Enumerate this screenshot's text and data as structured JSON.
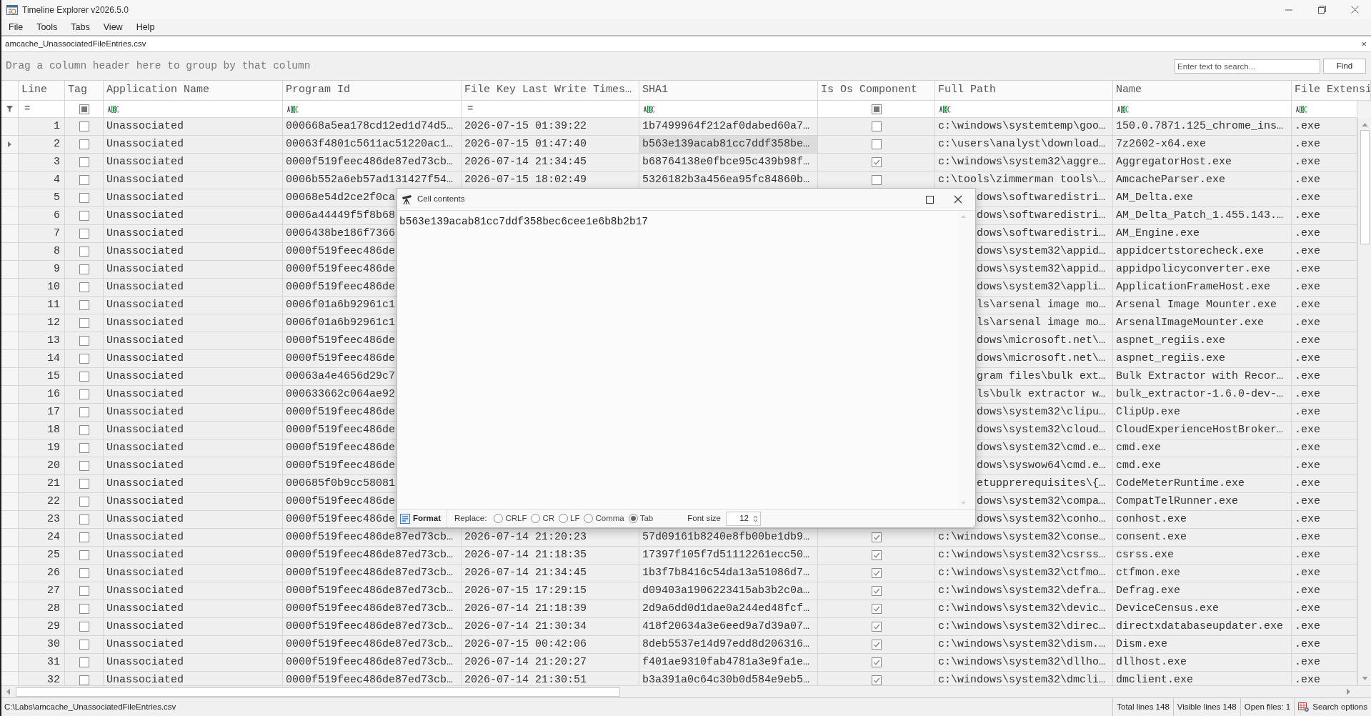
{
  "window": {
    "title": "Timeline Explorer v2026.5.0"
  },
  "menu": [
    "File",
    "Tools",
    "Tabs",
    "View",
    "Help"
  ],
  "tab": {
    "label": "amcache_UnassociatedFileEntries.csv",
    "close": "×"
  },
  "group_panel": {
    "hint": "Drag a column header here to group by that column"
  },
  "search": {
    "placeholder": "Enter text to search...",
    "button": "Find"
  },
  "columns": [
    {
      "label": "Line",
      "kind": "number",
      "filter": "="
    },
    {
      "label": "Tag",
      "kind": "check",
      "filter_indeterminate": true
    },
    {
      "label": "Application Name",
      "kind": "text"
    },
    {
      "label": "Program Id",
      "kind": "text"
    },
    {
      "label": "File Key Last Write Times…",
      "kind": "number",
      "filter": "="
    },
    {
      "label": "SHA1",
      "kind": "text"
    },
    {
      "label": "Is Os Component",
      "kind": "check",
      "filter_indeterminate": true
    },
    {
      "label": "Full Path",
      "kind": "text"
    },
    {
      "label": "Name",
      "kind": "text"
    },
    {
      "label": "File Extensi",
      "kind": "text"
    }
  ],
  "rows": [
    {
      "line": "1",
      "tagged": false,
      "app": "Unassociated",
      "program_id": "000668a5ea178cd12ed1d74d5…",
      "file_key_time": "2026-07-15 01:39:22",
      "sha1": "1b7499964f212af0dabed60a7…",
      "os_component": false,
      "full_path": "c:\\windows\\systemtemp\\goo…",
      "name": "150.0.7871.125_chrome_ins…",
      "ext": ".exe",
      "selected": false
    },
    {
      "line": "2",
      "tagged": false,
      "app": "Unassociated",
      "program_id": "00063f4801c5611ac51220ac1…",
      "file_key_time": "2026-07-15 01:47:40",
      "sha1": "b563e139acab81cc7ddf358be…",
      "os_component": false,
      "full_path": "c:\\users\\analyst\\download…",
      "name": "7z2602-x64.exe",
      "ext": ".exe",
      "selected": true
    },
    {
      "line": "3",
      "tagged": false,
      "app": "Unassociated",
      "program_id": "0000f519feec486de87ed73cb…",
      "file_key_time": "2026-07-14 21:34:45",
      "sha1": "b68764138e0fbce95c439b98f…",
      "os_component": true,
      "full_path": "c:\\windows\\system32\\aggre…",
      "name": "AggregatorHost.exe",
      "ext": ".exe",
      "selected": false
    },
    {
      "line": "4",
      "tagged": false,
      "app": "Unassociated",
      "program_id": "0006b552a6eb57ad131427f54…",
      "file_key_time": "2026-07-15 18:02:49",
      "sha1": "5326182b3a456ea95fc84860b…",
      "os_component": false,
      "full_path": "c:\\tools\\zimmerman tools\\…",
      "name": "AmcacheParser.exe",
      "ext": ".exe",
      "selected": false
    },
    {
      "line": "5",
      "tagged": false,
      "app": "Unassociated",
      "program_id": "00068e54d2ce2f0ca",
      "full_path": "dows\\softwaredistri…",
      "name": "AM_Delta.exe",
      "ext": ".exe",
      "selected": false
    },
    {
      "line": "6",
      "tagged": false,
      "app": "Unassociated",
      "program_id": "0006a44449f5f8b68",
      "full_path": "dows\\softwaredistri…",
      "name": "AM_Delta_Patch_1.455.143.…",
      "ext": ".exe",
      "selected": false
    },
    {
      "line": "7",
      "tagged": false,
      "app": "Unassociated",
      "program_id": "0006438be186f7366",
      "full_path": "dows\\softwaredistri…",
      "name": "AM_Engine.exe",
      "ext": ".exe",
      "selected": false
    },
    {
      "line": "8",
      "tagged": false,
      "app": "Unassociated",
      "program_id": "0000f519feec486de",
      "full_path": "dows\\system32\\appid…",
      "name": "appidcertstorecheck.exe",
      "ext": ".exe",
      "selected": false
    },
    {
      "line": "9",
      "tagged": false,
      "app": "Unassociated",
      "program_id": "0000f519feec486de",
      "full_path": "dows\\system32\\appid…",
      "name": "appidpolicyconverter.exe",
      "ext": ".exe",
      "selected": false
    },
    {
      "line": "10",
      "tagged": false,
      "app": "Unassociated",
      "program_id": "0000f519feec486de",
      "full_path": "dows\\system32\\appli…",
      "name": "ApplicationFrameHost.exe",
      "ext": ".exe",
      "selected": false
    },
    {
      "line": "11",
      "tagged": false,
      "app": "Unassociated",
      "program_id": "0006f01a6b92961c1",
      "full_path": "ls\\arsenal image mo…",
      "name": "Arsenal Image Mounter.exe",
      "ext": ".exe",
      "selected": false
    },
    {
      "line": "12",
      "tagged": false,
      "app": "Unassociated",
      "program_id": "0006f01a6b92961c1",
      "full_path": "ls\\arsenal image mo…",
      "name": "ArsenalImageMounter.exe",
      "ext": ".exe",
      "selected": false
    },
    {
      "line": "13",
      "tagged": false,
      "app": "Unassociated",
      "program_id": "0000f519feec486de",
      "full_path": "dows\\microsoft.net\\…",
      "name": "aspnet_regiis.exe",
      "ext": ".exe",
      "selected": false
    },
    {
      "line": "14",
      "tagged": false,
      "app": "Unassociated",
      "program_id": "0000f519feec486de",
      "full_path": "dows\\microsoft.net\\…",
      "name": "aspnet_regiis.exe",
      "ext": ".exe",
      "selected": false
    },
    {
      "line": "15",
      "tagged": false,
      "app": "Unassociated",
      "program_id": "00063a4e4656d29c7",
      "full_path": "gram files\\bulk ext…",
      "name": "Bulk Extractor with Recor…",
      "ext": ".exe",
      "selected": false
    },
    {
      "line": "16",
      "tagged": false,
      "app": "Unassociated",
      "program_id": "000633662c064ae92",
      "full_path": "ls\\bulk extractor w…",
      "name": "bulk_extractor-1.6.0-dev-…",
      "ext": ".exe",
      "selected": false
    },
    {
      "line": "17",
      "tagged": false,
      "app": "Unassociated",
      "program_id": "0000f519feec486de",
      "full_path": "dows\\system32\\clipu…",
      "name": "ClipUp.exe",
      "ext": ".exe",
      "selected": false
    },
    {
      "line": "18",
      "tagged": false,
      "app": "Unassociated",
      "program_id": "0000f519feec486de",
      "full_path": "dows\\system32\\cloud…",
      "name": "CloudExperienceHostBroker…",
      "ext": ".exe",
      "selected": false
    },
    {
      "line": "19",
      "tagged": false,
      "app": "Unassociated",
      "program_id": "0000f519feec486de",
      "full_path": "dows\\system32\\cmd.e…",
      "name": "cmd.exe",
      "ext": ".exe",
      "selected": false
    },
    {
      "line": "20",
      "tagged": false,
      "app": "Unassociated",
      "program_id": "0000f519feec486de",
      "full_path": "dows\\syswow64\\cmd.e…",
      "name": "cmd.exe",
      "ext": ".exe",
      "selected": false
    },
    {
      "line": "21",
      "tagged": false,
      "app": "Unassociated",
      "program_id": "000685f0b9cc58081",
      "full_path": "etupprerequisites\\{…",
      "name": "CodeMeterRuntime.exe",
      "ext": ".exe",
      "selected": false
    },
    {
      "line": "22",
      "tagged": false,
      "app": "Unassociated",
      "program_id": "0000f519feec486de",
      "full_path": "dows\\system32\\compa…",
      "name": "CompatTelRunner.exe",
      "ext": ".exe",
      "selected": false
    },
    {
      "line": "23",
      "tagged": false,
      "app": "Unassociated",
      "program_id": "0000f519feec486de",
      "full_path": "dows\\system32\\conho…",
      "name": "conhost.exe",
      "ext": ".exe",
      "selected": false
    },
    {
      "line": "24",
      "tagged": false,
      "app": "Unassociated",
      "program_id": "0000f519feec486de87ed73cb…",
      "file_key_time": "2026-07-14 21:20:23",
      "sha1": "57d09161b8240e8fb00be1db9…",
      "os_component": true,
      "full_path": "c:\\windows\\system32\\conse…",
      "name": "consent.exe",
      "ext": ".exe",
      "selected": false
    },
    {
      "line": "25",
      "tagged": false,
      "app": "Unassociated",
      "program_id": "0000f519feec486de87ed73cb…",
      "file_key_time": "2026-07-14 21:18:35",
      "sha1": "17397f105f7d51112261ecc50…",
      "os_component": true,
      "full_path": "c:\\windows\\system32\\csrss…",
      "name": "csrss.exe",
      "ext": ".exe",
      "selected": false
    },
    {
      "line": "26",
      "tagged": false,
      "app": "Unassociated",
      "program_id": "0000f519feec486de87ed73cb…",
      "file_key_time": "2026-07-14 21:34:45",
      "sha1": "1b3f7b8416c54da13a51086d7…",
      "os_component": true,
      "full_path": "c:\\windows\\system32\\ctfmo…",
      "name": "ctfmon.exe",
      "ext": ".exe",
      "selected": false
    },
    {
      "line": "27",
      "tagged": false,
      "app": "Unassociated",
      "program_id": "0000f519feec486de87ed73cb…",
      "file_key_time": "2026-07-15 17:29:15",
      "sha1": "d09403a1906223415ab3b2c0a…",
      "os_component": true,
      "full_path": "c:\\windows\\system32\\defra…",
      "name": "Defrag.exe",
      "ext": ".exe",
      "selected": false
    },
    {
      "line": "28",
      "tagged": false,
      "app": "Unassociated",
      "program_id": "0000f519feec486de87ed73cb…",
      "file_key_time": "2026-07-14 21:18:39",
      "sha1": "2d9a6dd0d1dae0a244ed48fcf…",
      "os_component": true,
      "full_path": "c:\\windows\\system32\\devic…",
      "name": "DeviceCensus.exe",
      "ext": ".exe",
      "selected": false
    },
    {
      "line": "29",
      "tagged": false,
      "app": "Unassociated",
      "program_id": "0000f519feec486de87ed73cb…",
      "file_key_time": "2026-07-14 21:30:34",
      "sha1": "418f20634a3e6eed9a7d39a07…",
      "os_component": true,
      "full_path": "c:\\windows\\system32\\direc…",
      "name": "directxdatabaseupdater.exe",
      "ext": ".exe",
      "selected": false
    },
    {
      "line": "30",
      "tagged": false,
      "app": "Unassociated",
      "program_id": "0000f519feec486de87ed73cb…",
      "file_key_time": "2026-07-15 00:42:06",
      "sha1": "8deb5537e14d97edd8d206316…",
      "os_component": true,
      "full_path": "c:\\windows\\system32\\dism.…",
      "name": "Dism.exe",
      "ext": ".exe",
      "selected": false
    },
    {
      "line": "31",
      "tagged": false,
      "app": "Unassociated",
      "program_id": "0000f519feec486de87ed73cb…",
      "file_key_time": "2026-07-14 21:20:27",
      "sha1": "f401ae9310fab4781a3e9fa1e…",
      "os_component": true,
      "full_path": "c:\\windows\\system32\\dllho…",
      "name": "dllhost.exe",
      "ext": ".exe",
      "selected": false
    },
    {
      "line": "32",
      "tagged": false,
      "app": "Unassociated",
      "program_id": "0000f519feec486de87ed73cb…",
      "file_key_time": "2026-07-14 21:30:51",
      "sha1": "b3a391a0c64c30b0d584e9eb5…",
      "os_component": true,
      "full_path": "c:\\windows\\system32\\dmcli…",
      "name": "dmclient.exe",
      "ext": ".exe",
      "selected": false
    }
  ],
  "dialog": {
    "title": "Cell contents",
    "text": "b563e139acab81cc7ddf358bec6cee1e6b8b2b17",
    "format_button": "Format",
    "replace_label": "Replace:",
    "replace_options": [
      {
        "label": "CRLF",
        "selected": false
      },
      {
        "label": "CR",
        "selected": false
      },
      {
        "label": "LF",
        "selected": false
      },
      {
        "label": "Comma",
        "selected": false
      },
      {
        "label": "Tab",
        "selected": true
      }
    ],
    "font_size_label": "Font size",
    "font_size": "12"
  },
  "status_bar": {
    "path": "C:\\Labs\\amcache_UnassociatedFileEntries.csv",
    "total": "Total lines 148",
    "visible": "Visible lines 148",
    "open_files": "Open files: 1",
    "search_options": "Search options"
  }
}
